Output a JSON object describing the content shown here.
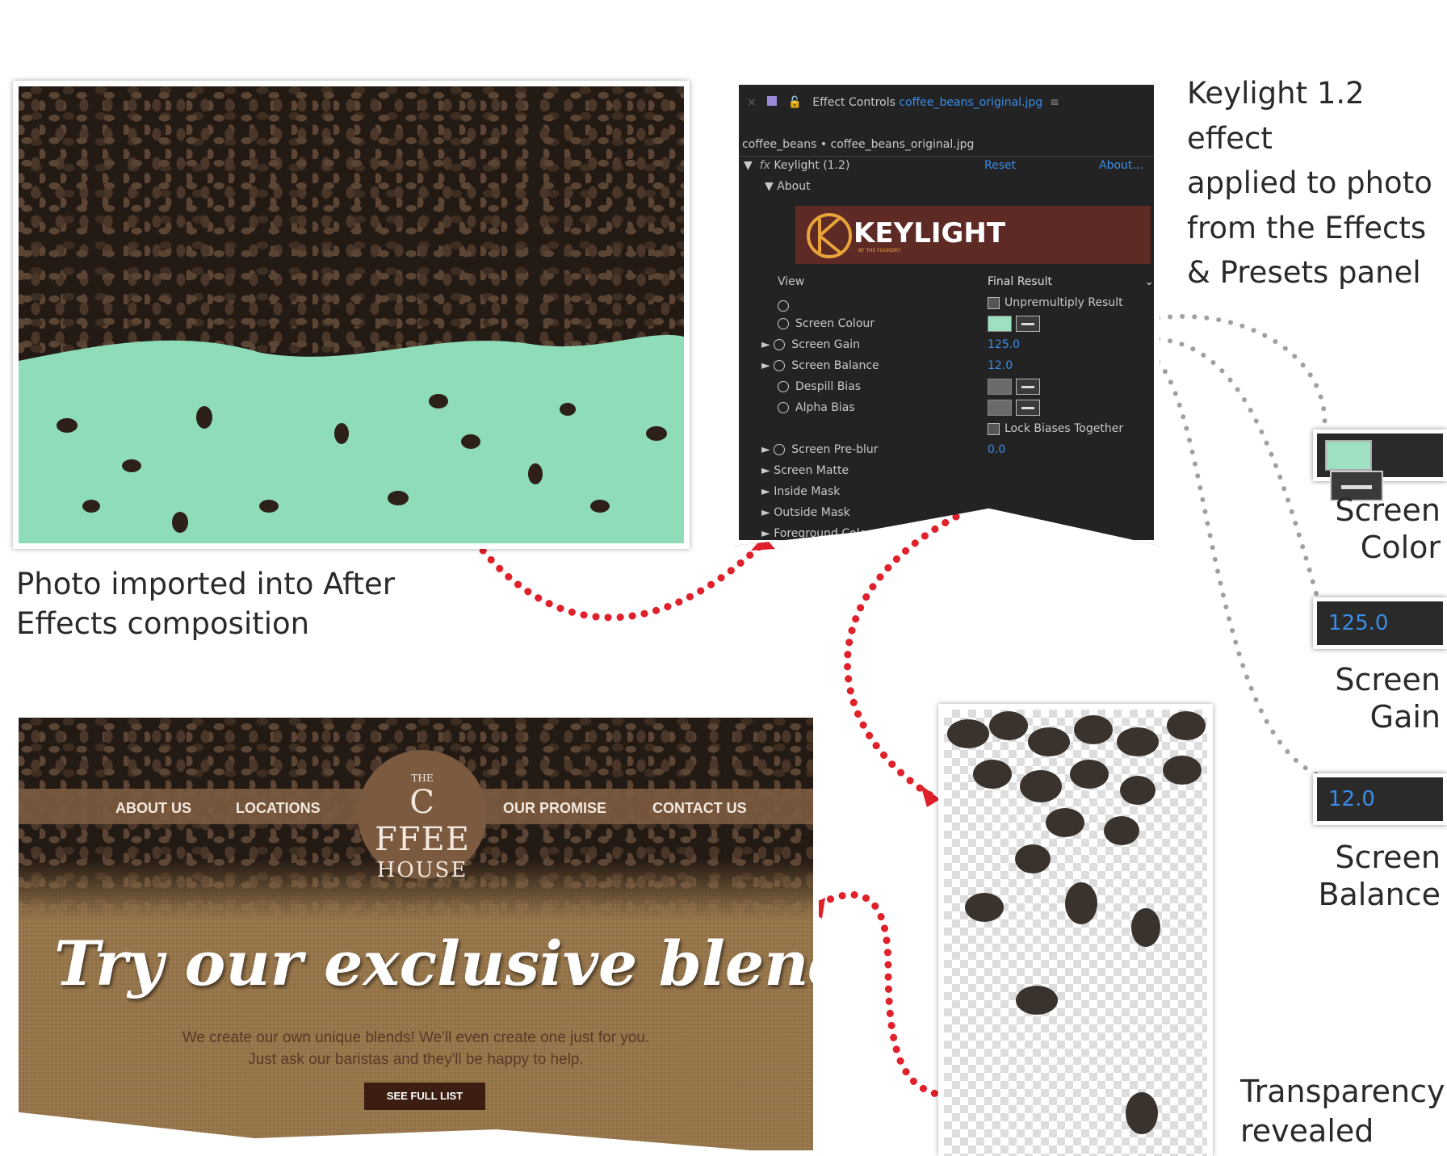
{
  "captions": {
    "photo_imported": [
      "Photo imported into After",
      "Effects composition"
    ],
    "keylight_applied": [
      "Keylight 1.2 effect",
      "applied to photo",
      "from the Effects",
      "& Presets panel"
    ],
    "screen_color": [
      "Screen",
      "Color"
    ],
    "screen_gain": [
      "Screen",
      "Gain"
    ],
    "screen_balance": [
      "Screen",
      "Balance"
    ],
    "transparency": [
      "Transparency",
      "revealed from"
    ]
  },
  "effect_controls": {
    "panel_title": "Effect Controls",
    "file_link": "coffee_beans_original.jpg",
    "layer_path": "coffee_beans • coffee_beans_original.jpg",
    "effect_name": "Keylight (1.2)",
    "reset": "Reset",
    "about_link": "About...",
    "about_group": "About",
    "logo_text": "KEYLIGHT",
    "logo_subtext": "BY THE FOUNDRY",
    "view_label": "View",
    "view_value": "Final Result",
    "unpremultiply": "Unpremultiply Result",
    "screen_colour": "Screen Colour",
    "screen_colour_hex": "#9ee0bf",
    "screen_gain_label": "Screen Gain",
    "screen_gain_value": "125.0",
    "screen_balance_label": "Screen Balance",
    "screen_balance_value": "12.0",
    "despill_bias": "Despill Bias",
    "alpha_bias": "Alpha Bias",
    "lock_biases": "Lock Biases Together",
    "screen_preblur": "Screen Pre-blur",
    "screen_preblur_value": "0.0",
    "screen_matte": "Screen Matte",
    "inside_mask": "Inside Mask",
    "outside_mask": "Outside Mask",
    "foreground": "Foreground Colour Correction"
  },
  "callouts": {
    "gain_value": "125.0",
    "balance_value": "12.0"
  },
  "website": {
    "nav_left": [
      "ABOUT US",
      "LOCATIONS"
    ],
    "nav_right": [
      "OUR PROMISE",
      "CONTACT US"
    ],
    "logo_the": "THE",
    "logo_coffee": "C FFEE",
    "logo_house": "HOUSE",
    "headline": "Try our exclusive blends",
    "body_line1": "We create our own unique blends!  We'll even create one just for you.",
    "body_line2": "Just ask our baristas and they'll be happy to help.",
    "cta": "SEE FULL LIST"
  },
  "colors": {
    "mint": "#8fdcb8",
    "accent_blue": "#3a8de8",
    "nav_brown": "#7b5a40",
    "burlap": "#9c7a4e",
    "dots_red": "#e0202a",
    "dots_gray": "#9a9a9a"
  }
}
